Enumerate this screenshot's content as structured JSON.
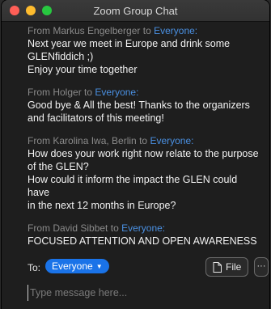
{
  "window": {
    "title": "Zoom Group Chat"
  },
  "messages": [
    {
      "prefix": "From",
      "sender": "Markus Engelberger",
      "to_word": "to",
      "recipient": "Everyone:",
      "lines": [
        "Next year we meet in Europe and drink some",
        "GLENfiddich ;)",
        "Enjoy your time together"
      ]
    },
    {
      "prefix": "From",
      "sender": "Holger",
      "to_word": "to",
      "recipient": "Everyone:",
      "lines": [
        "Good bye & All the best! Thanks to the organizers",
        "and facilitators of this meeting!"
      ]
    },
    {
      "prefix": "From",
      "sender": "Karolina Iwa, Berlin",
      "to_word": "to",
      "recipient": "Everyone:",
      "lines": [
        "How does your work right now relate to the purpose",
        "of the GLEN?",
        "How could it inform the impact the GLEN could have",
        "in the next 12 months in Europe?"
      ]
    },
    {
      "prefix": "From",
      "sender": "David Sibbet",
      "to_word": "to",
      "recipient": "Everyone:",
      "lines": [
        "FOCUSED ATTENTION AND OPEN AWARENESS"
      ]
    }
  ],
  "composer": {
    "to_label": "To:",
    "recipient": "Everyone",
    "file_label": "File",
    "more_label": "···",
    "placeholder": "Type message here..."
  }
}
